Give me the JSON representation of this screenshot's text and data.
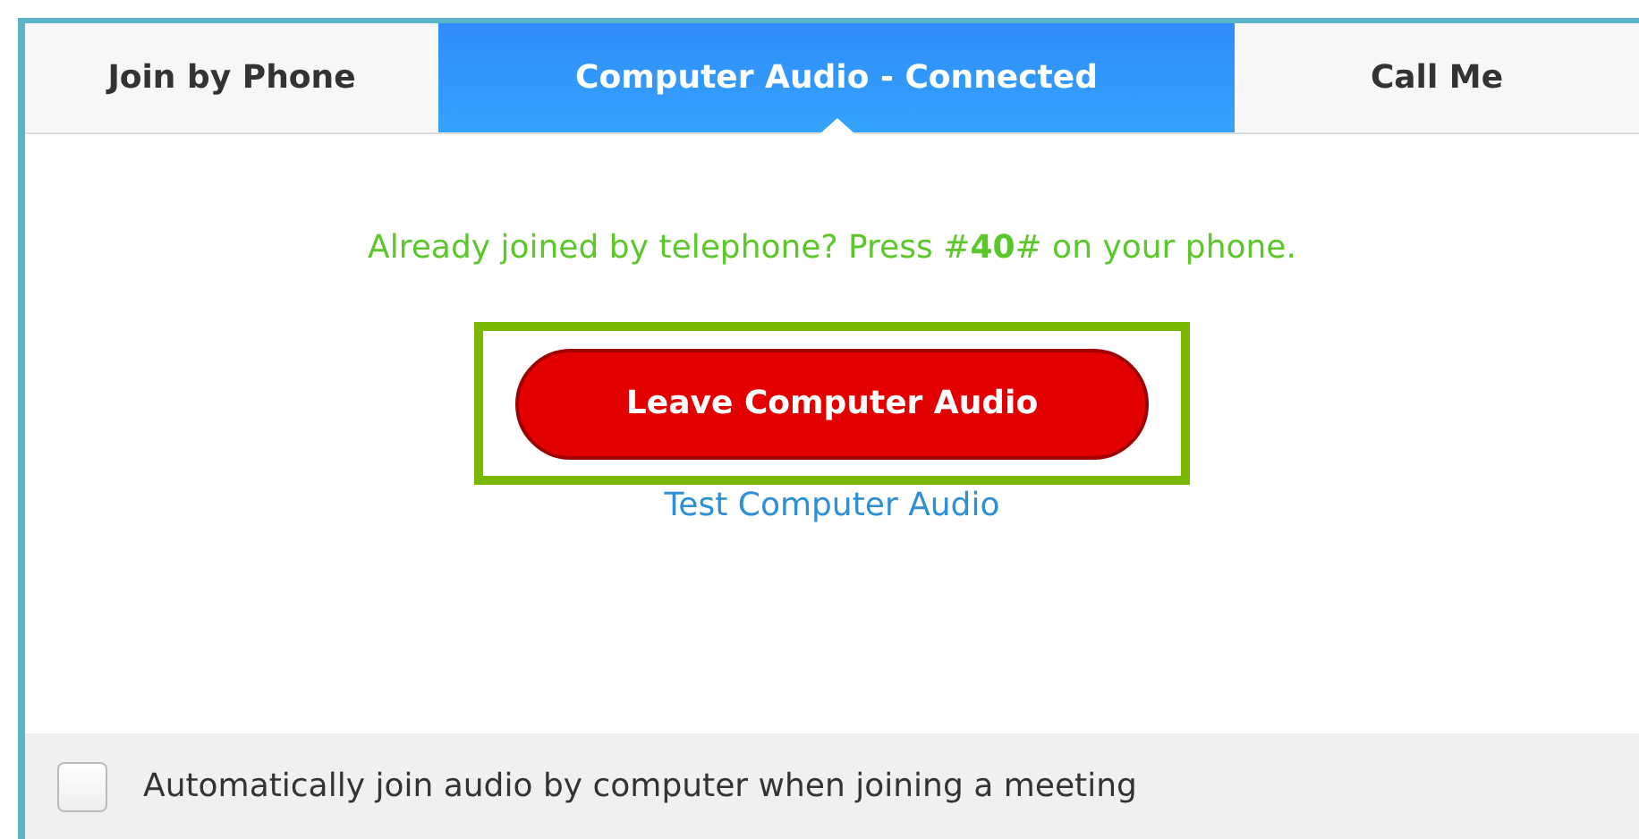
{
  "tabs": [
    {
      "label": "Join by Phone",
      "selected": false
    },
    {
      "label": "Computer Audio - Connected",
      "selected": true
    },
    {
      "label": "Call Me",
      "selected": false
    }
  ],
  "message": "Already joined by telephone? Press #**40**# on your phone.",
  "primary_button": "Leave Computer Audio",
  "link": "Test Computer Audio",
  "footer": {
    "checkbox_label": "Automatically join audio by computer when joining a meeting",
    "checked": false
  }
}
